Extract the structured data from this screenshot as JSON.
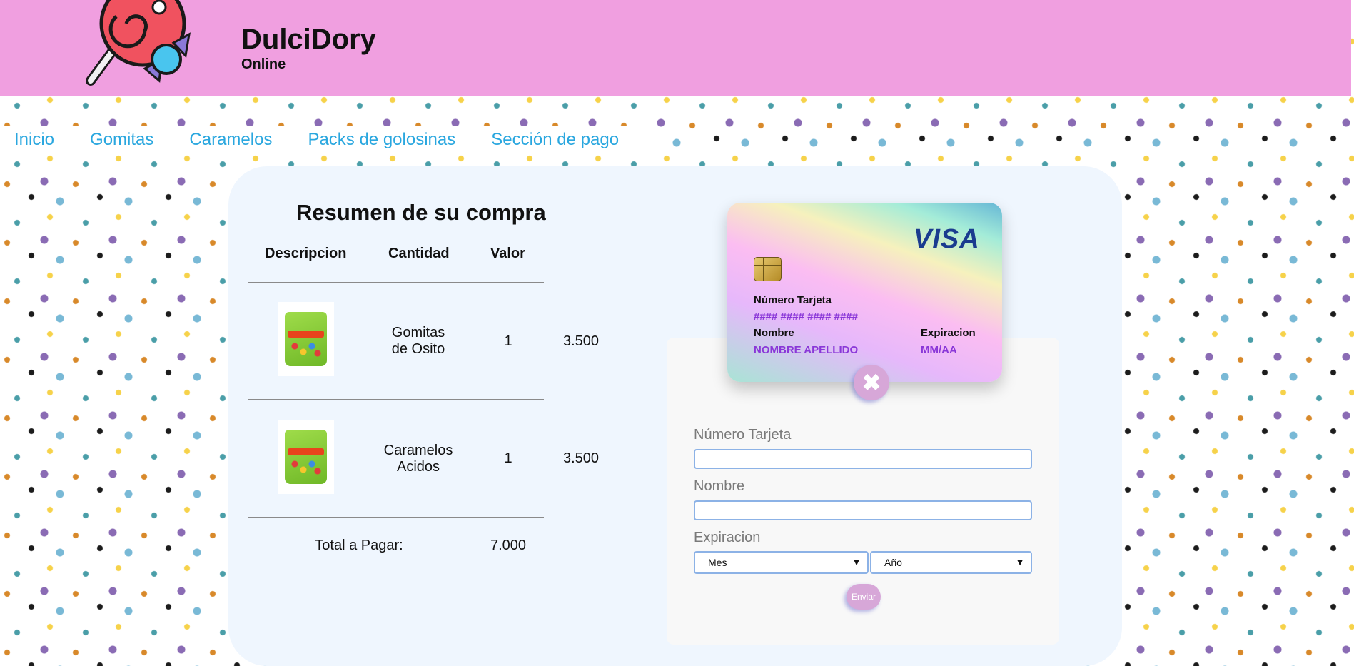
{
  "brand": {
    "name": "DulciDory",
    "subtitle": "Online"
  },
  "nav": {
    "items": [
      "Inicio",
      "Gomitas",
      "Caramelos",
      "Packs de golosinas",
      "Sección de pago"
    ]
  },
  "summary": {
    "title": "Resumen de su compra",
    "headers": [
      "Descripcion",
      "Cantidad",
      "Valor"
    ],
    "rows": [
      {
        "desc_line1": "Gomitas",
        "desc_line2": "de Osito",
        "qty": "1",
        "value": "3.500"
      },
      {
        "desc_line1": "Caramelos",
        "desc_line2": "Acidos",
        "qty": "1",
        "value": "3.500"
      }
    ],
    "total_label": "Total a Pagar:",
    "total_value": "7.000"
  },
  "card": {
    "brand": "VISA",
    "number_label": "Número Tarjeta",
    "number_value": "#### #### #### ####",
    "name_label": "Nombre",
    "name_value": "NOMBRE APELLIDO",
    "exp_label": "Expiracion",
    "exp_value": "MM/AA"
  },
  "form": {
    "number_label": "Número Tarjeta",
    "name_label": "Nombre",
    "exp_label": "Expiracion",
    "month_selected": "Mes",
    "year_selected": "Año",
    "submit_label": "Enviar",
    "close_glyph": "✖"
  },
  "colors": {
    "header_bg": "#f09fe0",
    "nav_link": "#2aa7df",
    "panel_bg": "#eff6fe",
    "card_value": "#8a37d8",
    "button": "#d7a7d8"
  }
}
